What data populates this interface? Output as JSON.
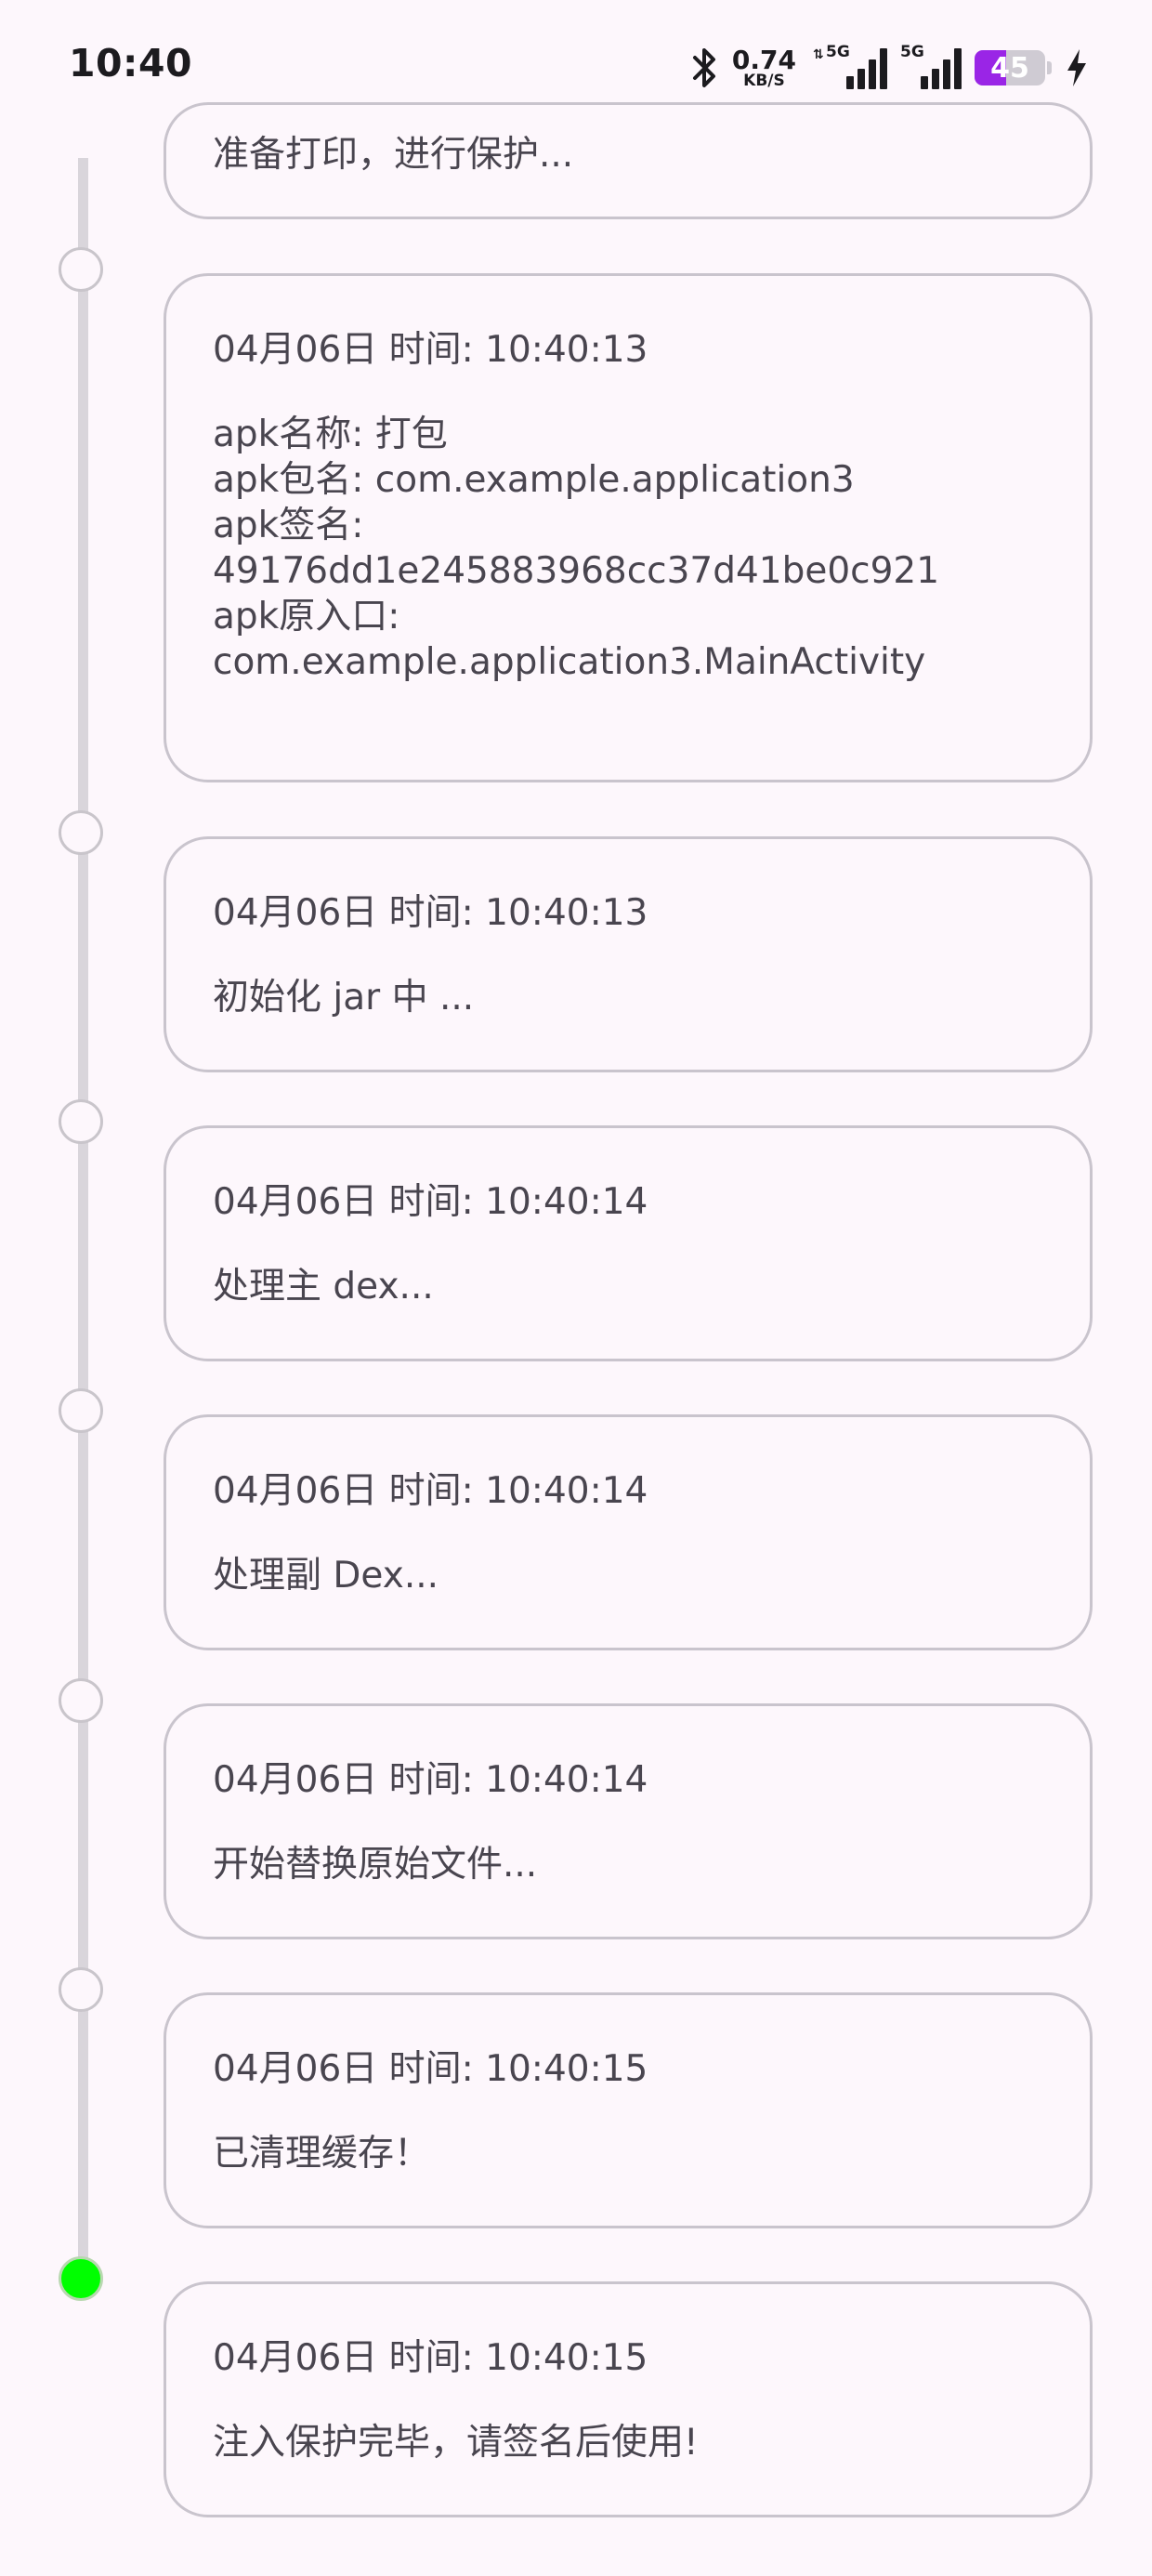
{
  "status_bar": {
    "time": "10:40",
    "net_speed_value": "0.74",
    "net_speed_unit": "KB/S",
    "signal1_label": "5G",
    "signal2_label": "5G",
    "battery_percent": "45",
    "battery_level": 0.45,
    "battery_color": "#9a25e6",
    "icons": [
      "bluetooth-icon",
      "data-arrows-icon",
      "signal-icon",
      "battery-icon",
      "charging-icon"
    ]
  },
  "timeline": {
    "active_color": "#00ff00",
    "partial_entry_text": "准备打印，进行保护...",
    "entries": [
      {
        "timestamp": "04月06日 时间: 10:40:13",
        "message": "apk名称: 打包\napk包名: com.example.application3\napk签名:\n49176dd1e245883968cc37d41be0c921\napk原入口:\ncom.example.application3.MainActivity"
      },
      {
        "timestamp": "04月06日 时间: 10:40:13",
        "message": "初始化 jar 中 ..."
      },
      {
        "timestamp": "04月06日 时间: 10:40:14",
        "message": "处理主 dex..."
      },
      {
        "timestamp": "04月06日 时间: 10:40:14",
        "message": "处理副 Dex..."
      },
      {
        "timestamp": "04月06日 时间: 10:40:14",
        "message": "开始替换原始文件..."
      },
      {
        "timestamp": "04月06日 时间: 10:40:15",
        "message": "已清理缓存！"
      },
      {
        "timestamp": "04月06日 时间: 10:40:15",
        "message": "注入保护完毕，请签名后使用!"
      }
    ]
  }
}
